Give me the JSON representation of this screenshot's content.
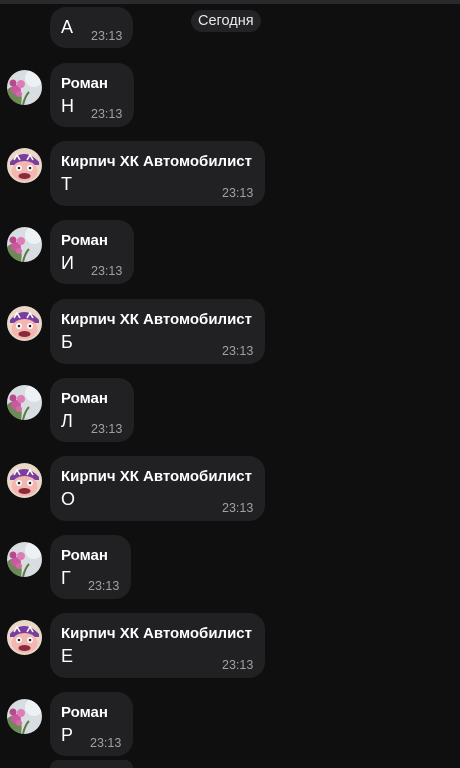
{
  "date_chip": "Сегодня",
  "messages": [
    {
      "sender": "",
      "text": "А",
      "time": "23:13"
    },
    {
      "sender": "Роман",
      "text": "Н",
      "time": "23:13"
    },
    {
      "sender": "Кирпич ХК Автомобилист",
      "text": "Т",
      "time": "23:13"
    },
    {
      "sender": "Роман",
      "text": "И",
      "time": "23:13"
    },
    {
      "sender": "Кирпич ХК Автомобилист",
      "text": "Б",
      "time": "23:13"
    },
    {
      "sender": "Роман",
      "text": "Л",
      "time": "23:13"
    },
    {
      "sender": "Кирпич ХК Автомобилист",
      "text": "О",
      "time": "23:13"
    },
    {
      "sender": "Роман",
      "text": "Г",
      "time": "23:13"
    },
    {
      "sender": "Кирпич ХК Автомобилист",
      "text": "Е",
      "time": "23:13"
    },
    {
      "sender": "Роман",
      "text": "Р",
      "time": "23:13"
    }
  ],
  "avatars": {
    "roman": "flower-photo-avatar",
    "kirpich": "cartoon-face-avatar"
  },
  "colors": {
    "background": "#0f0f10",
    "bubble": "#212123",
    "time": "#a0a0a3"
  }
}
